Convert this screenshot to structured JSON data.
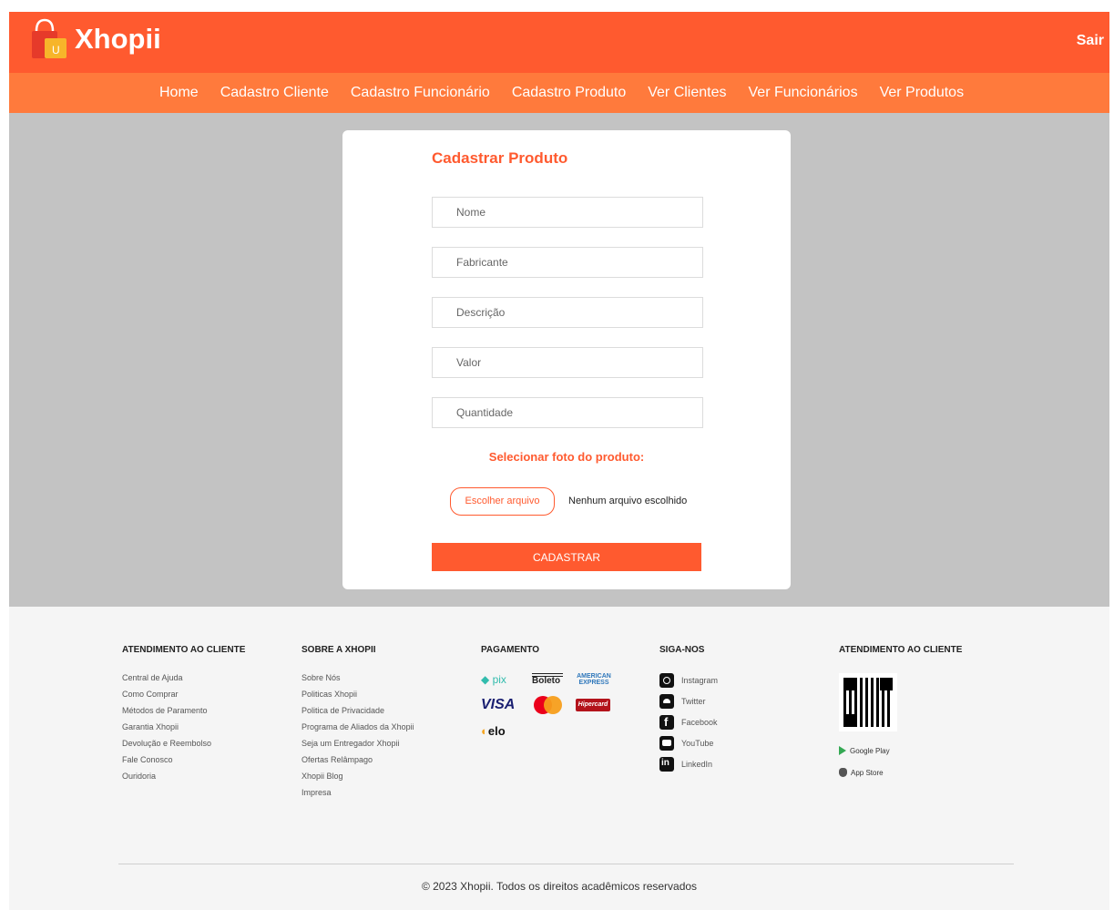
{
  "header": {
    "brand": "Xhopii",
    "logout_label": "Sair",
    "brand_color": "#ff5a2f"
  },
  "nav": {
    "items": [
      {
        "label": "Home"
      },
      {
        "label": "Cadastro Cliente"
      },
      {
        "label": "Cadastro Funcionário"
      },
      {
        "label": "Cadastro Produto"
      },
      {
        "label": "Ver Clientes"
      },
      {
        "label": "Ver Funcionários"
      },
      {
        "label": "Ver Produtos"
      }
    ]
  },
  "form": {
    "title": "Cadastrar Produto",
    "fields": [
      {
        "placeholder": "Nome",
        "value": ""
      },
      {
        "placeholder": "Fabricante",
        "value": ""
      },
      {
        "placeholder": "Descrição",
        "value": ""
      },
      {
        "placeholder": "Valor",
        "value": ""
      },
      {
        "placeholder": "Quantidade",
        "value": ""
      }
    ],
    "photo_label": "Selecionar foto do produto:",
    "file_button": "Escolher arquivo",
    "file_status": "Nenhum arquivo escolhido",
    "submit_label": "CADASTRAR"
  },
  "footer": {
    "customer_service": {
      "heading": "ATENDIMENTO AO CLIENTE",
      "links": [
        "Central de Ajuda",
        "Como Comprar",
        "Métodos de Paramento",
        "Garantia Xhopii",
        "Devolução e Reembolso",
        "Fale Conosco",
        "Ouridoria"
      ]
    },
    "about": {
      "heading": "SOBRE A XHOPII",
      "links": [
        "Sobre Nós",
        "Politicas Xhopii",
        "Politica de Privacidade",
        "Programa de Aliados da Xhopii",
        "Seja um Entregador Xhopii",
        "Ofertas Relâmpago",
        "Xhopii Blog",
        "Impresa"
      ]
    },
    "payment": {
      "heading": "PAGAMENTO",
      "methods": {
        "pix": "pix",
        "boleto": "Boleto",
        "amex": "AMERICAN EXPRESS",
        "visa": "VISA",
        "hipercard": "Hipercard",
        "elo": "elo"
      }
    },
    "social": {
      "heading": "SIGA-NOS",
      "links": [
        "Instagram",
        "Twitter",
        "Facebook",
        "YouTube",
        "LinkedIn"
      ]
    },
    "apps": {
      "heading": "ATENDIMENTO AO CLIENTE",
      "google_play": "Google Play",
      "app_store": "App Store"
    },
    "copyright": "© 2023 Xhopii. Todos os direitos acadêmicos reservados"
  }
}
